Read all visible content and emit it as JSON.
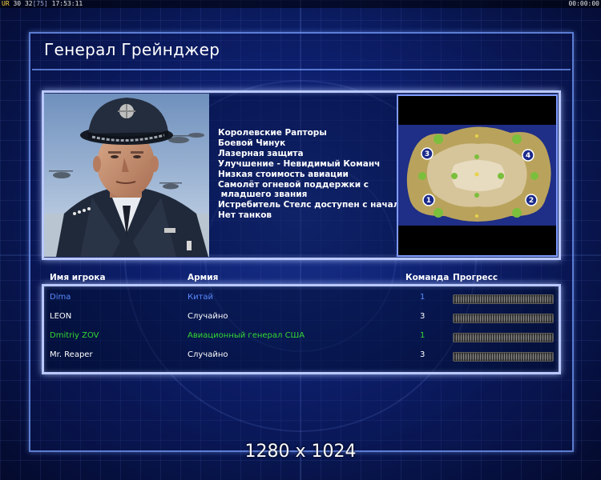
{
  "statusbar": {
    "ur": "UR",
    "n1": "30",
    "n2": "32",
    "n3": "[75]",
    "time": "17:53:11",
    "right_time": "00:00:00"
  },
  "title": "Генерал Грейнджер",
  "features": [
    "Королевские Рапторы",
    "Боевой Чинук",
    "Лазерная защита",
    "Улучшение - Невидимый Команч",
    "Низкая стоимость авиации",
    "Самолёт огневой поддержки с",
    " младшего звания",
    "Истребитель Стелс доступен с начала",
    "Нет танков"
  ],
  "minimap": {
    "start_labels": [
      "1",
      "2",
      "3",
      "4"
    ]
  },
  "table": {
    "headers": {
      "player": "Имя игрока",
      "army": "Армия",
      "team": "Команда",
      "progress": "Прогресс"
    },
    "rows": [
      {
        "name": "Dima",
        "army": "Китай",
        "team": "1",
        "color": "#5a8cff",
        "army_color": "#5a8cff",
        "team_color": "#5a8cff"
      },
      {
        "name": "LEON",
        "army": "Случайно",
        "team": "3",
        "color": "#ffffff",
        "army_color": "#ffffff",
        "team_color": "#ffffff"
      },
      {
        "name": "Dmitriy ZOV",
        "army": "Авиационный генерал США",
        "team": "1",
        "color": "#34d832",
        "army_color": "#34d832",
        "team_color": "#34d832"
      },
      {
        "name": "Mr. Reaper",
        "army": "Случайно",
        "team": "3",
        "color": "#ffffff",
        "army_color": "#ffffff",
        "team_color": "#ffffff"
      }
    ]
  },
  "resolution": "1280 x 1024",
  "colors": {
    "frame": "#7f9cff",
    "panel_border": "#b9c8ff",
    "background": "#0f2478"
  }
}
